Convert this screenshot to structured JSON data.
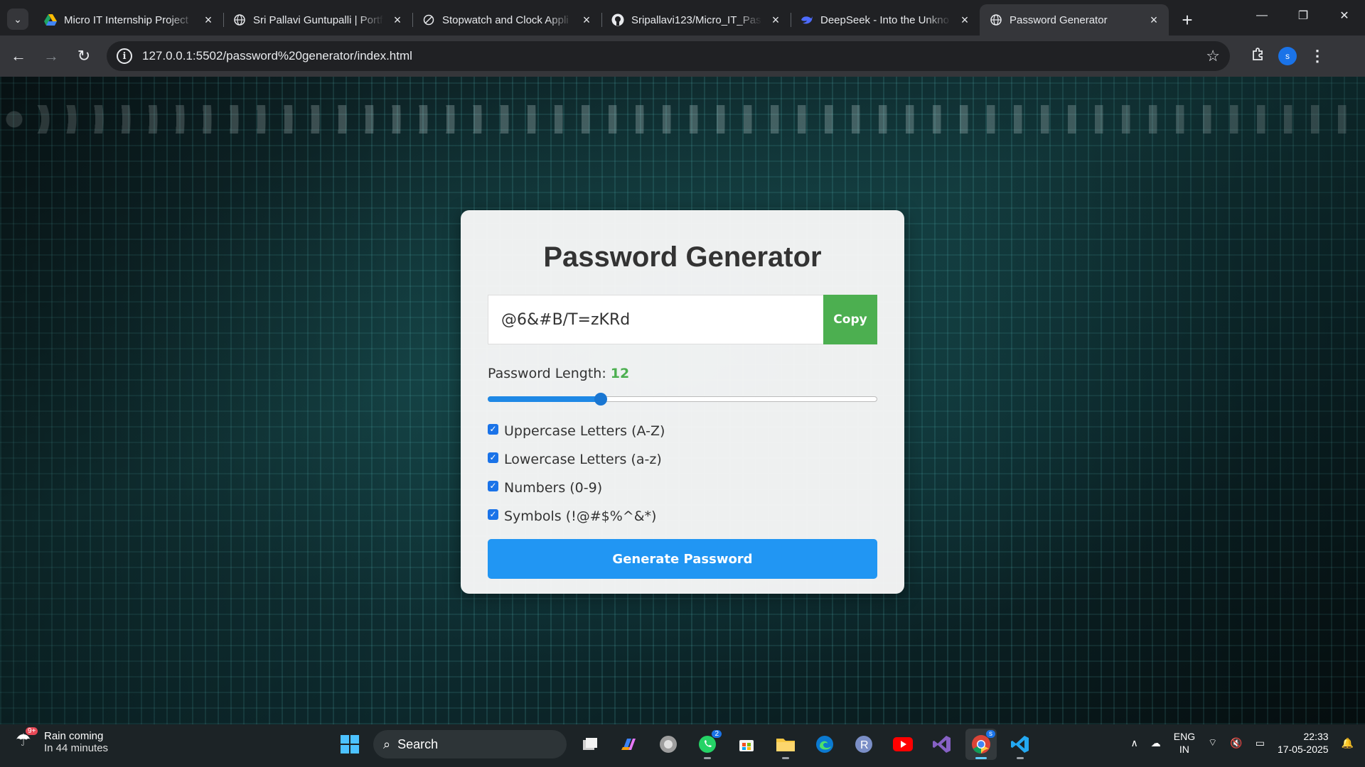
{
  "browser": {
    "tabs": [
      {
        "title": "Micro IT Internship Project",
        "icon": "google-drive-icon"
      },
      {
        "title": "Sri Pallavi Guntupalli | Portf",
        "icon": "globe-icon"
      },
      {
        "title": "Stopwatch and Clock Appli",
        "icon": "stopwatch-icon"
      },
      {
        "title": "Sripallavi123/Micro_IT_Pass",
        "icon": "github-icon"
      },
      {
        "title": "DeepSeek - Into the Unkno",
        "icon": "deepseek-icon"
      },
      {
        "title": "Password Generator",
        "icon": "globe-icon",
        "active": true
      }
    ],
    "url": "127.0.0.1:5502/password%20generator/index.html",
    "profile_initial": "s"
  },
  "app": {
    "title": "Password Generator",
    "password": "@6&#B/T=zKRd",
    "copy_label": "Copy",
    "length_label": "Password Length:",
    "length_value": "12",
    "length_fraction": 0.29,
    "options": [
      {
        "label": "Uppercase Letters (A-Z)",
        "checked": true
      },
      {
        "label": "Lowercase Letters (a-z)",
        "checked": true
      },
      {
        "label": "Numbers (0-9)",
        "checked": true
      },
      {
        "label": "Symbols (!@#$%^&*)",
        "checked": true
      }
    ],
    "generate_label": "Generate Password",
    "colors": {
      "accent_green": "#4caf50",
      "accent_blue": "#2196f3"
    }
  },
  "taskbar": {
    "weather_badge": "9+",
    "weather_title": "Rain coming",
    "weather_sub": "In 44 minutes",
    "search_placeholder": "Search",
    "whatsapp_badge": "2",
    "chrome_badge": "s",
    "lang_1": "ENG",
    "lang_2": "IN",
    "time": "22:33",
    "date": "17-05-2025"
  }
}
